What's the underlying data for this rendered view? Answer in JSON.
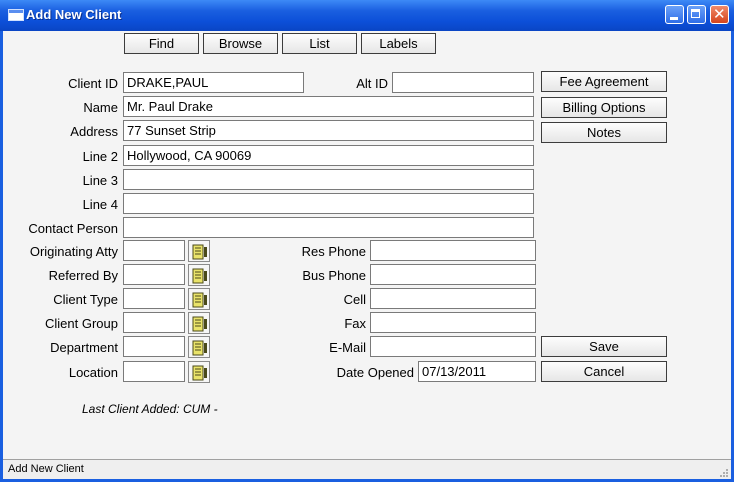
{
  "window": {
    "title": "Add New Client"
  },
  "toolbar": {
    "find": "Find",
    "browse": "Browse",
    "list": "List",
    "labels": "Labels"
  },
  "labels": {
    "client_id": "Client ID",
    "alt_id": "Alt ID",
    "name": "Name",
    "address": "Address",
    "line2": "Line 2",
    "line3": "Line 3",
    "line4": "Line 4",
    "contact_person": "Contact Person",
    "originating_atty": "Originating Atty",
    "referred_by": "Referred By",
    "client_type": "Client Type",
    "client_group": "Client Group",
    "department": "Department",
    "location": "Location",
    "res_phone": "Res Phone",
    "bus_phone": "Bus Phone",
    "cell": "Cell",
    "fax": "Fax",
    "email": "E-Mail",
    "date_opened": "Date Opened"
  },
  "values": {
    "client_id": "DRAKE,PAUL",
    "alt_id": "",
    "name": "Mr. Paul Drake",
    "address": "77 Sunset Strip",
    "line2": "Hollywood, CA 90069",
    "line3": "",
    "line4": "",
    "contact_person": "",
    "originating_atty": "",
    "referred_by": "",
    "client_type": "",
    "client_group": "",
    "department": "",
    "location": "",
    "res_phone": "",
    "bus_phone": "",
    "cell": "",
    "fax": "",
    "email": "",
    "date_opened": "07/13/2011"
  },
  "side_buttons": {
    "fee_agreement": "Fee Agreement",
    "billing_options": "Billing Options",
    "notes": "Notes",
    "save": "Save",
    "cancel": "Cancel"
  },
  "note": "Last Client Added: CUM -",
  "status": "Add New Client",
  "icons": {
    "lookup": "lookup-list-icon",
    "app": "window-icon"
  },
  "colors": {
    "titlebar": "#0c4fd8",
    "close_button": "#d6451d",
    "lookup_icon": "#e9e36a"
  }
}
